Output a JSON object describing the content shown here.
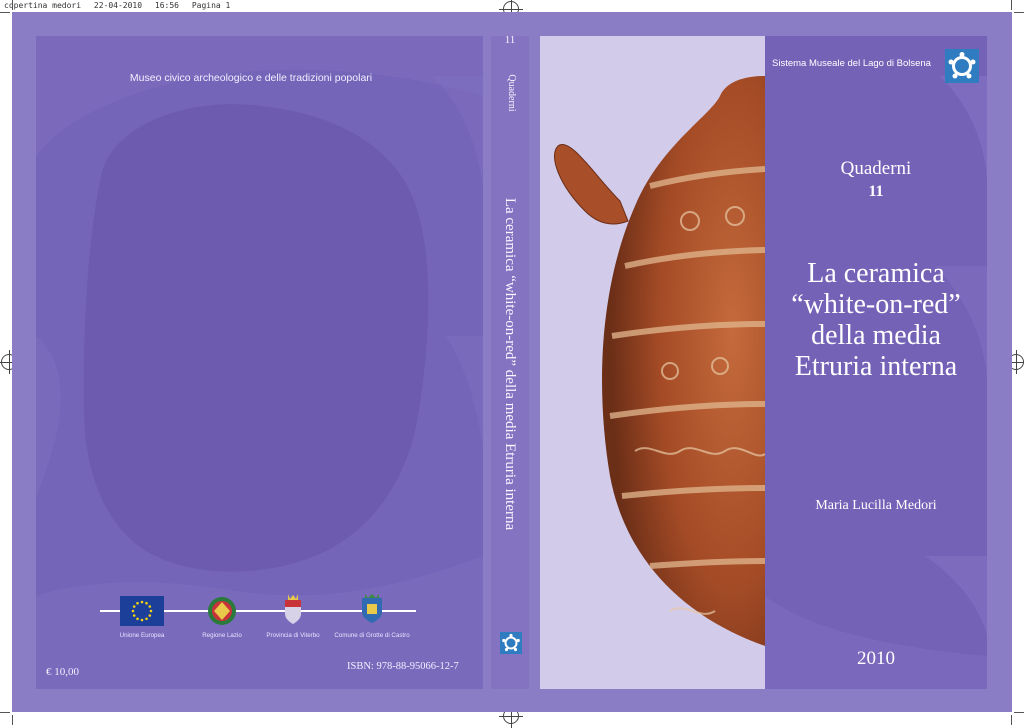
{
  "slug": {
    "filename": "copertina medori",
    "date": "22-04-2010",
    "time": "16:56",
    "page": "Pagina 1"
  },
  "back_cover": {
    "museum": "Museo civico archeologico e delle tradizioni popolari",
    "logos": [
      {
        "icon": "eu-flag-icon",
        "caption": "Unione Europea"
      },
      {
        "icon": "regione-lazio-emblem-icon",
        "caption": "Regione Lazio"
      },
      {
        "icon": "provincia-viterbo-crest-icon",
        "caption": "Provincia di Viterbo"
      },
      {
        "icon": "grotte-di-castro-crest-icon",
        "caption": "Comune di Grotte di Castro"
      }
    ],
    "price": "€ 10,00",
    "isbn": "ISBN: 978-88-95066-12-7"
  },
  "spine": {
    "number": "11",
    "series": "Quaderni",
    "title": "La ceramica “white-on-red” della media Etruria interna"
  },
  "front_cover": {
    "system": "Sistema Museale del Lago di Bolsena",
    "series": "Quaderni",
    "number": "11",
    "title_lines": [
      "La ceramica",
      "“white-on-red”",
      "della media",
      "Etruria interna"
    ],
    "author": "Maria Lucilla Medori",
    "year": "2010"
  },
  "colors": {
    "bleed": "#8b7cc6",
    "panel": "#7565b8",
    "photo_bg": "#d2cbea",
    "vase_red": "#b0512b",
    "accent_blue": "#2f7cc0"
  }
}
